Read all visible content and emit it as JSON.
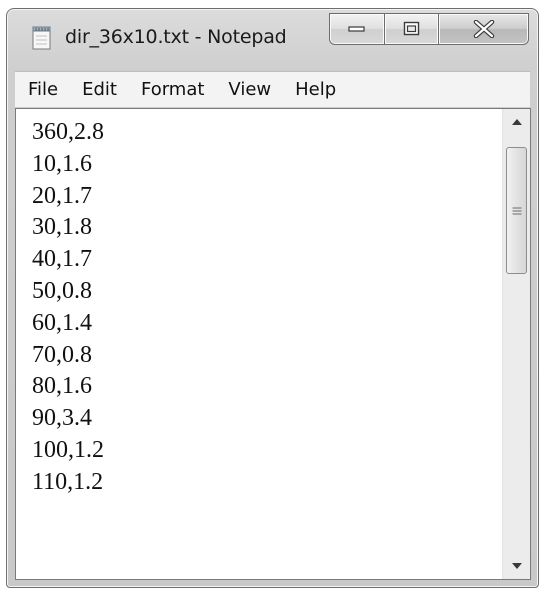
{
  "window": {
    "title": "dir_36x10.txt - Notepad"
  },
  "caption_buttons": {
    "minimize_icon": "minimize-icon",
    "maximize_icon": "maximize-icon",
    "close_icon": "close-icon"
  },
  "menu": {
    "items": [
      {
        "label": "File"
      },
      {
        "label": "Edit"
      },
      {
        "label": "Format"
      },
      {
        "label": "View"
      },
      {
        "label": "Help"
      }
    ]
  },
  "editor": {
    "lines": [
      "360,2.8",
      "10,1.6",
      "20,1.7",
      "30,1.8",
      "40,1.7",
      "50,0.8",
      "60,1.4",
      "70,0.8",
      "80,1.6",
      "90,3.4",
      "100,1.2",
      "110,1.2"
    ]
  },
  "scrollbar": {
    "up_icon": "scroll-up-arrow-icon",
    "down_icon": "scroll-down-arrow-icon",
    "grip_icon": "scroll-grip-icon"
  },
  "colors": {
    "frame": "#cfcfcf",
    "menubar": "#f3f3f3",
    "editor_bg": "#ffffff",
    "text": "#111111"
  }
}
